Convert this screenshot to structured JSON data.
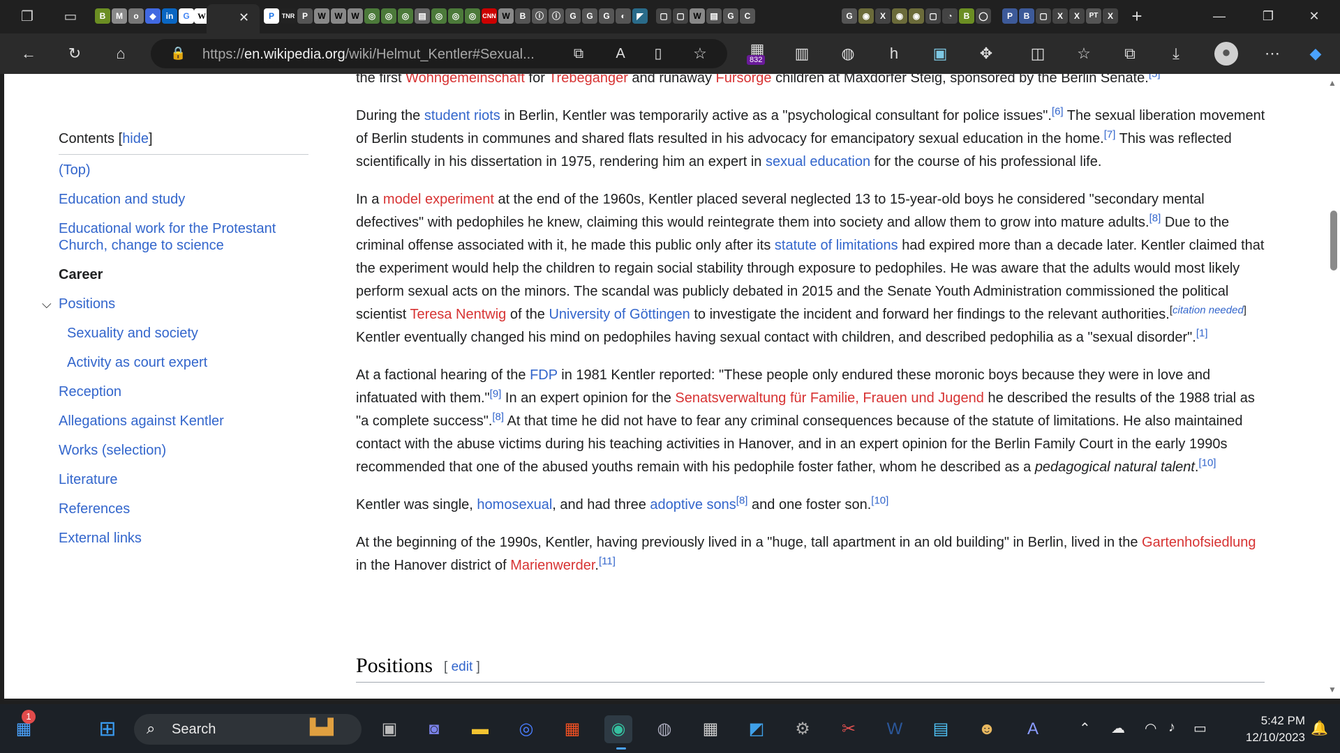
{
  "browser": {
    "url_host": "en.wikipedia.org",
    "url_prefix": "https://",
    "url_path": "/wiki/Helmut_Kentler#Sexual...",
    "tab_close": "✕",
    "new_tab": "+",
    "collection_badge": "832"
  },
  "toc": {
    "heading": "Contents",
    "hide": "hide",
    "items": [
      {
        "label": "(Top)"
      },
      {
        "label": "Education and study"
      },
      {
        "label": "Educational work for the Protestant Church, change to science"
      },
      {
        "label": "Career"
      },
      {
        "label": "Positions"
      },
      {
        "label": "Sexuality and society"
      },
      {
        "label": "Activity as court expert"
      },
      {
        "label": "Reception"
      },
      {
        "label": "Allegations against Kentler"
      },
      {
        "label": "Works (selection)"
      },
      {
        "label": "Literature"
      },
      {
        "label": "References"
      },
      {
        "label": "External links"
      }
    ]
  },
  "article": {
    "p0": {
      "a": "the first ",
      "link1": "Wohngemeinschaft",
      "b": " for ",
      "link2": "Trebegänger",
      "c": " and runaway ",
      "link3": "Fürsorge",
      "d": " children at Maxdorfer Steig, sponsored by the Berlin Senate.",
      "ref": "[5]"
    },
    "p1": {
      "a": "During the ",
      "link1": "student riots",
      "b": " in Berlin, Kentler was temporarily active as a \"psychological consultant for police issues\".",
      "ref1": "[6]",
      "c": " The sexual liberation movement of Berlin students in communes and shared flats resulted in his advocacy for emancipatory sexual education in the home.",
      "ref2": "[7]",
      "d": " This was reflected scientifically in his dissertation in 1975, rendering him an expert in ",
      "link2": "sexual education",
      "e": " for the course of his professional life."
    },
    "p2": {
      "a": "In a ",
      "link1": "model experiment",
      "b": " at the end of the 1960s, Kentler placed several neglected 13 to 15-year-old boys he considered \"secondary mental defectives\" with pedophiles he knew, claiming this would reintegrate them into society and allow them to grow into mature adults.",
      "ref1": "[8]",
      "c": " Due to the criminal offense associated with it, he made this public only after its ",
      "link2": "statute of limitations",
      "d": " had expired more than a decade later. Kentler claimed that the experiment would help the children to regain social stability through exposure to pedophiles. He was aware that the adults would most likely perform sexual acts on the minors. The scandal was publicly debated in 2015 and the Senate Youth Administration commissioned the political scientist ",
      "link3": "Teresa Nentwig",
      "e": " of the ",
      "link4": "University of Göttingen",
      "f": " to investigate the incident and forward her findings to the relevant authorities.",
      "cn_open": "[",
      "cn": "citation needed",
      "cn_close": "]",
      "g": " Kentler eventually changed his mind on pedophiles having sexual contact with children, and described pedophilia as a \"sexual disorder\".",
      "ref2": "[1]"
    },
    "p3": {
      "a": "At a factional hearing of the ",
      "link1": "FDP",
      "b": " in 1981 Kentler reported: \"These people only endured these moronic boys because they were in love and infatuated with them.\"",
      "ref1": "[9]",
      "c": " In an expert opinion for the ",
      "link2": "Senatsverwaltung für Familie, Frauen und Jugend",
      "d": " he described the results of the 1988 trial as \"a complete success\".",
      "ref2": "[8]",
      "e": " At that time he did not have to fear any criminal consequences because of the statute of limitations. He also maintained contact with the abuse victims during his teaching activities in Hanover, and in an expert opinion for the Berlin Family Court in the early 1990s recommended that one of the abused youths remain with his pedophile foster father, whom he described as a ",
      "em": "pedagogical natural talent",
      "f": ".",
      "ref3": "[10]"
    },
    "p4": {
      "a": "Kentler was single, ",
      "link1": "homosexual",
      "b": ", and had three ",
      "link2": "adoptive sons",
      "ref1": "[8]",
      "c": " and one foster son.",
      "ref2": "[10]"
    },
    "p5": {
      "a": "At the beginning of the 1990s, Kentler, having previously lived in a \"huge, tall apartment in an old building\" in Berlin, lived in the ",
      "link1": "Gartenhofsiedlung",
      "b": " in the Hanover district of ",
      "link2": "Marienwerder",
      "c": ".",
      "ref": "[11]"
    },
    "heading": "Positions",
    "edit_open": "[ ",
    "edit": "edit",
    "edit_close": " ]"
  },
  "taskbar": {
    "search_label": "Search",
    "notification_count": "1",
    "time": "5:42 PM",
    "date": "12/10/2023"
  },
  "colors": {
    "link": "#3366cc",
    "redlink": "#d73333",
    "taskbar": "#1c2127",
    "browser_chrome": "#2b2b2b"
  }
}
